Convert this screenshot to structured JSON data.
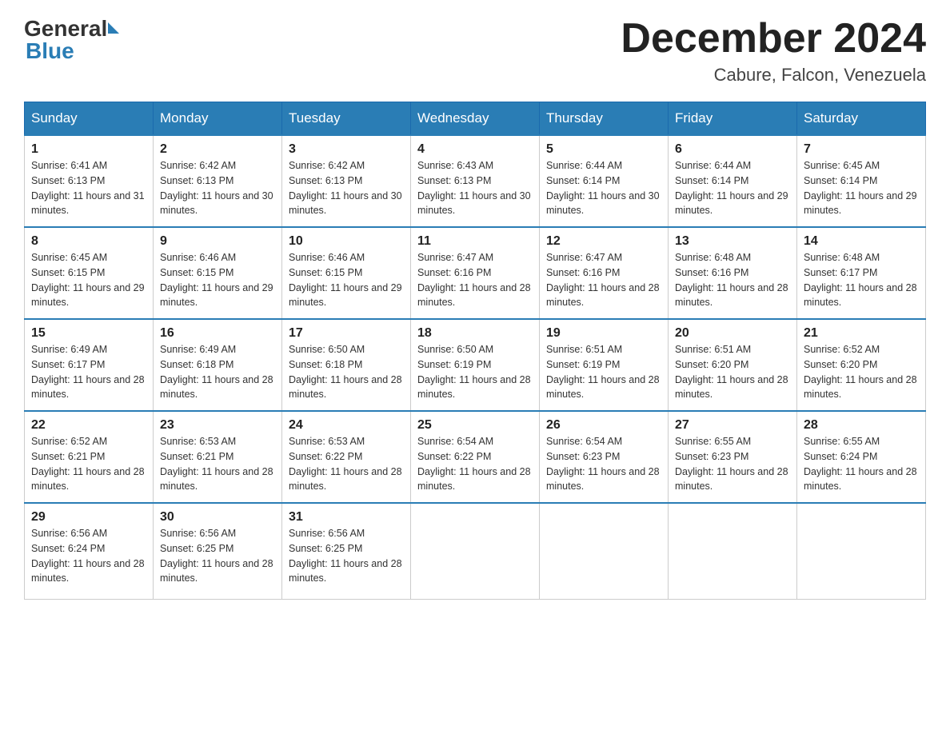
{
  "header": {
    "logo_general": "General",
    "logo_blue": "Blue",
    "month_title": "December 2024",
    "location": "Cabure, Falcon, Venezuela"
  },
  "days_of_week": [
    "Sunday",
    "Monday",
    "Tuesday",
    "Wednesday",
    "Thursday",
    "Friday",
    "Saturday"
  ],
  "weeks": [
    [
      {
        "day": "1",
        "sunrise": "Sunrise: 6:41 AM",
        "sunset": "Sunset: 6:13 PM",
        "daylight": "Daylight: 11 hours and 31 minutes."
      },
      {
        "day": "2",
        "sunrise": "Sunrise: 6:42 AM",
        "sunset": "Sunset: 6:13 PM",
        "daylight": "Daylight: 11 hours and 30 minutes."
      },
      {
        "day": "3",
        "sunrise": "Sunrise: 6:42 AM",
        "sunset": "Sunset: 6:13 PM",
        "daylight": "Daylight: 11 hours and 30 minutes."
      },
      {
        "day": "4",
        "sunrise": "Sunrise: 6:43 AM",
        "sunset": "Sunset: 6:13 PM",
        "daylight": "Daylight: 11 hours and 30 minutes."
      },
      {
        "day": "5",
        "sunrise": "Sunrise: 6:44 AM",
        "sunset": "Sunset: 6:14 PM",
        "daylight": "Daylight: 11 hours and 30 minutes."
      },
      {
        "day": "6",
        "sunrise": "Sunrise: 6:44 AM",
        "sunset": "Sunset: 6:14 PM",
        "daylight": "Daylight: 11 hours and 29 minutes."
      },
      {
        "day": "7",
        "sunrise": "Sunrise: 6:45 AM",
        "sunset": "Sunset: 6:14 PM",
        "daylight": "Daylight: 11 hours and 29 minutes."
      }
    ],
    [
      {
        "day": "8",
        "sunrise": "Sunrise: 6:45 AM",
        "sunset": "Sunset: 6:15 PM",
        "daylight": "Daylight: 11 hours and 29 minutes."
      },
      {
        "day": "9",
        "sunrise": "Sunrise: 6:46 AM",
        "sunset": "Sunset: 6:15 PM",
        "daylight": "Daylight: 11 hours and 29 minutes."
      },
      {
        "day": "10",
        "sunrise": "Sunrise: 6:46 AM",
        "sunset": "Sunset: 6:15 PM",
        "daylight": "Daylight: 11 hours and 29 minutes."
      },
      {
        "day": "11",
        "sunrise": "Sunrise: 6:47 AM",
        "sunset": "Sunset: 6:16 PM",
        "daylight": "Daylight: 11 hours and 28 minutes."
      },
      {
        "day": "12",
        "sunrise": "Sunrise: 6:47 AM",
        "sunset": "Sunset: 6:16 PM",
        "daylight": "Daylight: 11 hours and 28 minutes."
      },
      {
        "day": "13",
        "sunrise": "Sunrise: 6:48 AM",
        "sunset": "Sunset: 6:16 PM",
        "daylight": "Daylight: 11 hours and 28 minutes."
      },
      {
        "day": "14",
        "sunrise": "Sunrise: 6:48 AM",
        "sunset": "Sunset: 6:17 PM",
        "daylight": "Daylight: 11 hours and 28 minutes."
      }
    ],
    [
      {
        "day": "15",
        "sunrise": "Sunrise: 6:49 AM",
        "sunset": "Sunset: 6:17 PM",
        "daylight": "Daylight: 11 hours and 28 minutes."
      },
      {
        "day": "16",
        "sunrise": "Sunrise: 6:49 AM",
        "sunset": "Sunset: 6:18 PM",
        "daylight": "Daylight: 11 hours and 28 minutes."
      },
      {
        "day": "17",
        "sunrise": "Sunrise: 6:50 AM",
        "sunset": "Sunset: 6:18 PM",
        "daylight": "Daylight: 11 hours and 28 minutes."
      },
      {
        "day": "18",
        "sunrise": "Sunrise: 6:50 AM",
        "sunset": "Sunset: 6:19 PM",
        "daylight": "Daylight: 11 hours and 28 minutes."
      },
      {
        "day": "19",
        "sunrise": "Sunrise: 6:51 AM",
        "sunset": "Sunset: 6:19 PM",
        "daylight": "Daylight: 11 hours and 28 minutes."
      },
      {
        "day": "20",
        "sunrise": "Sunrise: 6:51 AM",
        "sunset": "Sunset: 6:20 PM",
        "daylight": "Daylight: 11 hours and 28 minutes."
      },
      {
        "day": "21",
        "sunrise": "Sunrise: 6:52 AM",
        "sunset": "Sunset: 6:20 PM",
        "daylight": "Daylight: 11 hours and 28 minutes."
      }
    ],
    [
      {
        "day": "22",
        "sunrise": "Sunrise: 6:52 AM",
        "sunset": "Sunset: 6:21 PM",
        "daylight": "Daylight: 11 hours and 28 minutes."
      },
      {
        "day": "23",
        "sunrise": "Sunrise: 6:53 AM",
        "sunset": "Sunset: 6:21 PM",
        "daylight": "Daylight: 11 hours and 28 minutes."
      },
      {
        "day": "24",
        "sunrise": "Sunrise: 6:53 AM",
        "sunset": "Sunset: 6:22 PM",
        "daylight": "Daylight: 11 hours and 28 minutes."
      },
      {
        "day": "25",
        "sunrise": "Sunrise: 6:54 AM",
        "sunset": "Sunset: 6:22 PM",
        "daylight": "Daylight: 11 hours and 28 minutes."
      },
      {
        "day": "26",
        "sunrise": "Sunrise: 6:54 AM",
        "sunset": "Sunset: 6:23 PM",
        "daylight": "Daylight: 11 hours and 28 minutes."
      },
      {
        "day": "27",
        "sunrise": "Sunrise: 6:55 AM",
        "sunset": "Sunset: 6:23 PM",
        "daylight": "Daylight: 11 hours and 28 minutes."
      },
      {
        "day": "28",
        "sunrise": "Sunrise: 6:55 AM",
        "sunset": "Sunset: 6:24 PM",
        "daylight": "Daylight: 11 hours and 28 minutes."
      }
    ],
    [
      {
        "day": "29",
        "sunrise": "Sunrise: 6:56 AM",
        "sunset": "Sunset: 6:24 PM",
        "daylight": "Daylight: 11 hours and 28 minutes."
      },
      {
        "day": "30",
        "sunrise": "Sunrise: 6:56 AM",
        "sunset": "Sunset: 6:25 PM",
        "daylight": "Daylight: 11 hours and 28 minutes."
      },
      {
        "day": "31",
        "sunrise": "Sunrise: 6:56 AM",
        "sunset": "Sunset: 6:25 PM",
        "daylight": "Daylight: 11 hours and 28 minutes."
      },
      {
        "day": "",
        "sunrise": "",
        "sunset": "",
        "daylight": ""
      },
      {
        "day": "",
        "sunrise": "",
        "sunset": "",
        "daylight": ""
      },
      {
        "day": "",
        "sunrise": "",
        "sunset": "",
        "daylight": ""
      },
      {
        "day": "",
        "sunrise": "",
        "sunset": "",
        "daylight": ""
      }
    ]
  ]
}
